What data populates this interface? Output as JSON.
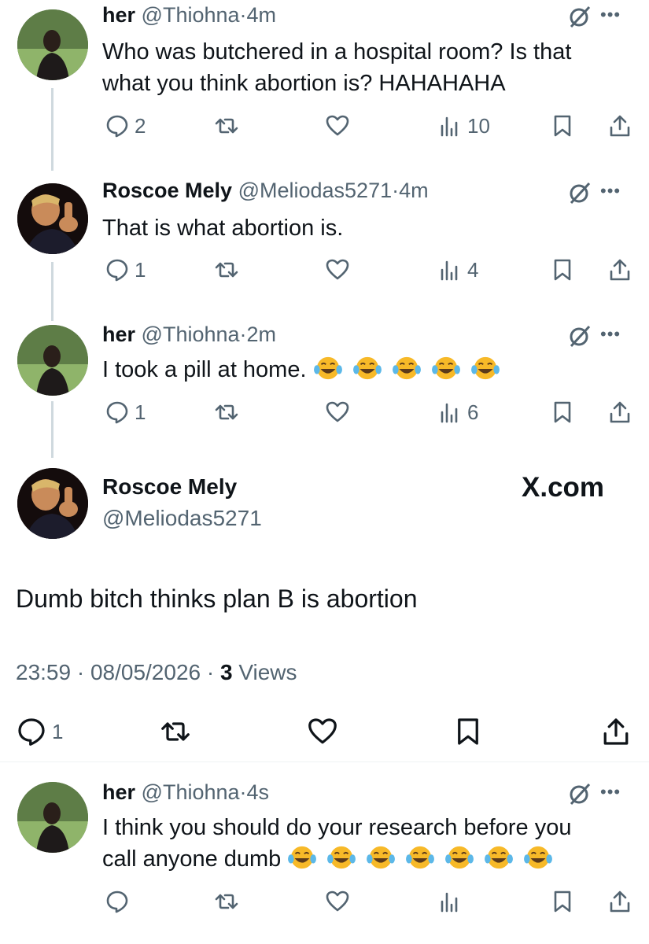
{
  "replies": [
    {
      "author": "her",
      "handle": "@Thiohna",
      "sep": "·",
      "time": "4m",
      "line1": "Who was butchered in a hospital room? Is that",
      "line2": "what you think abortion is? HAHAHAHA",
      "replies": "2",
      "retweets": "",
      "likes": "",
      "views": "10"
    },
    {
      "author": "Roscoe Mely",
      "handle": "@Meliodas5271",
      "sep": "·",
      "time": "4m",
      "line1": "That is what abortion is.",
      "replies": "1",
      "views": "4"
    },
    {
      "author": "her",
      "handle": "@Thiohna",
      "sep": "·",
      "time": "2m",
      "line1": "I took a pill at home.",
      "emoji_count": 5,
      "replies": "1",
      "views": "6"
    }
  ],
  "main_tweet": {
    "author": "Roscoe Mely",
    "handle": "@Meliodas5271",
    "brand": "X.com",
    "text": "Dumb bitch thinks plan B is abortion",
    "timestamp": "23:59 · 08/05/2026 · ",
    "views_count": "3",
    "views_label": " Views",
    "replies": "1"
  },
  "last_reply": {
    "author": "her",
    "handle": "@Thiohna",
    "sep": "·",
    "time": "4s",
    "line1": "I think you should do your research before you",
    "line2": "call anyone dumb",
    "emoji_count": 7
  },
  "icons": {
    "reply": "reply-icon",
    "retweet": "retweet-icon",
    "like": "heart-icon",
    "views": "views-icon",
    "bookmark": "bookmark-icon",
    "share": "share-icon",
    "grok": "grok-icon",
    "more": "more-icon",
    "emoji": "laughing-emoji"
  },
  "colors": {
    "text": "#0f1419",
    "muted": "#536471",
    "line": "#cfd9de",
    "emoji": "#f7b928"
  }
}
